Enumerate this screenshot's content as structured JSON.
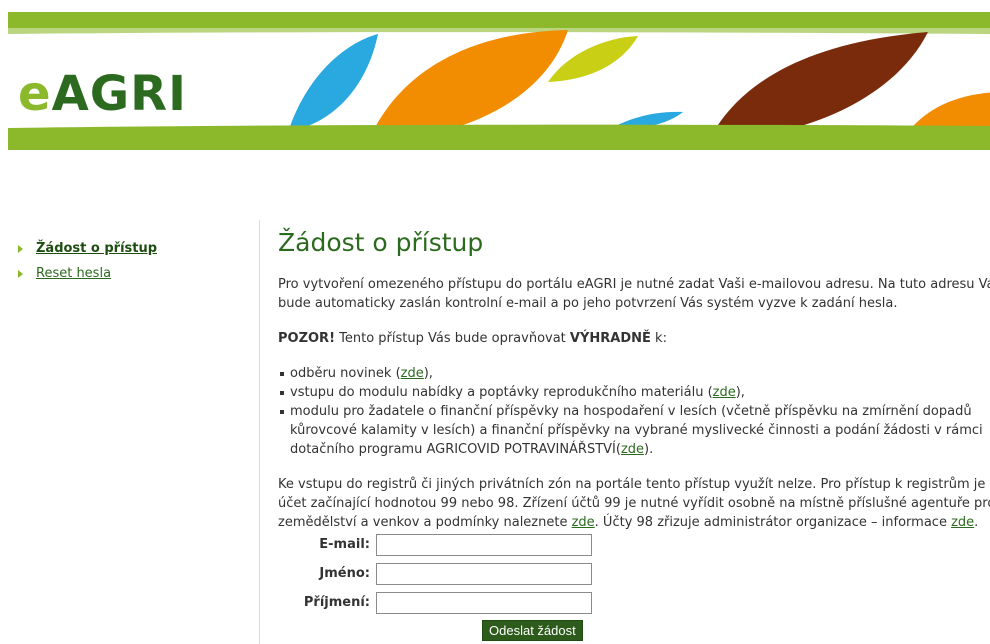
{
  "header": {
    "logo_prefix": "e",
    "logo_main": "AGRI",
    "colors": {
      "green": "#8cb82b",
      "orange": "#f28c00",
      "blue": "#2aa9e0",
      "lime": "#c8cf14",
      "brown": "#7a2b0c"
    }
  },
  "sidebar": {
    "items": [
      {
        "label": "Žádost o přístup",
        "active": true
      },
      {
        "label": "Reset hesla",
        "active": false
      }
    ]
  },
  "main": {
    "title": "Žádost o přístup",
    "intro_line1": "Pro vytvoření omezeného přístupu do portálu eAGRI je nutné zadat Vaši e-mailovou adresu. Na tuto adresu Vám",
    "intro_line2": "bude automaticky zaslán kontrolní e-mail a po jeho potvrzení Vás systém vyzve k zadání hesla.",
    "warning_label": "POZOR!",
    "warning_text": " Tento přístup Vás bude opravňovat ",
    "warning_strong": "VÝHRADNĚ",
    "warning_end": " k:",
    "bullets": {
      "b1_text": "odběru novinek (",
      "b1_link": "zde",
      "b1_end": "),",
      "b2_text": "vstupu do modulu nabídky a poptávky reprodukčního materiálu (",
      "b2_link": "zde",
      "b2_end": "),",
      "b3_line1": "modulu pro žadatele o finanční příspěvky na hospodaření v lesích (včetně příspěvku na zmírnění dopadů",
      "b3_line2": "kůrovcové kalamity v lesích) a finanční příspěvky na vybrané myslivecké činnosti a podání žádosti v rámci",
      "b3_line3": "dotačního programu AGRICOVID POTRAVINÁŘSTVÍ(",
      "b3_link": "zde",
      "b3_end": ")."
    },
    "registry_line1": "Ke vstupu do registrů či jiných privátních zón na portále tento přístup využít nelze. Pro přístup k registrům je vlast",
    "registry_line2": "účet začínající hodnotou 99 nebo 98. Zřízení účtů 99 je nutné vyřídit osobně na místně příslušné agentuře pro",
    "registry_line3a": "zemědělství a venkov a podmínky naleznete ",
    "registry_link1": "zde",
    "registry_line3b": ". Účty 98 zřizuje administrátor organizace – informace ",
    "registry_link2": "zde",
    "registry_line3c": "."
  },
  "form": {
    "email_label": "E-mail:",
    "email_value": "",
    "firstname_label": "Jméno:",
    "firstname_value": "",
    "lastname_label": "Příjmení:",
    "lastname_value": "",
    "submit_label": "Odeslat žádost"
  }
}
